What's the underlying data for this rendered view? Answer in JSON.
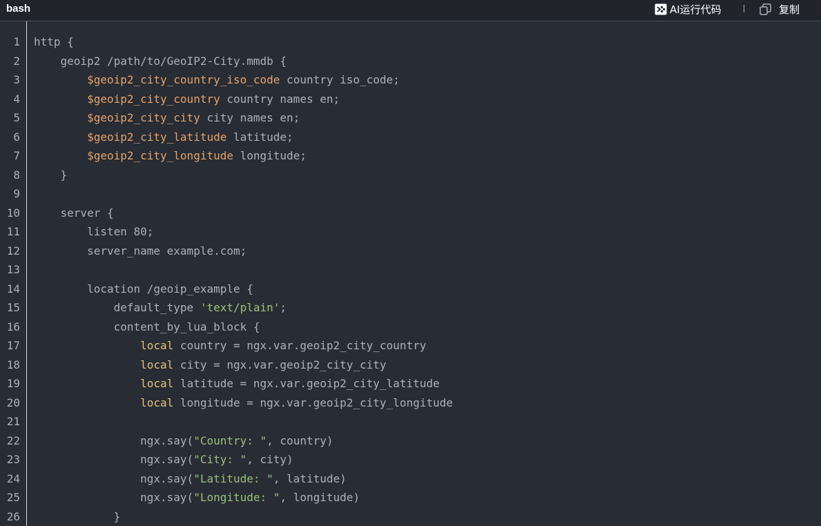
{
  "toolbar": {
    "language": "bash",
    "ai_run_label": "AI运行代码",
    "ai_run_icon": "ai-run-icon",
    "copy_label": "复制",
    "copy_icon": "copy-icon"
  },
  "colors": {
    "background": "#282c34",
    "toolbar_background": "#21252b",
    "plain_text": "#abb2bf",
    "variable": "#e5a46b",
    "keyword": "#e5c07b",
    "string": "#98c379"
  },
  "code": {
    "lines": [
      {
        "n": "1",
        "tokens": [
          {
            "t": "plain",
            "v": "http {"
          }
        ]
      },
      {
        "n": "2",
        "tokens": [
          {
            "t": "plain",
            "v": "    geoip2 /path/to/GeoIP2-City.mmdb {"
          }
        ]
      },
      {
        "n": "3",
        "tokens": [
          {
            "t": "plain",
            "v": "        "
          },
          {
            "t": "var",
            "v": "$geoip2_city_country_iso_code"
          },
          {
            "t": "plain",
            "v": " country iso_code;"
          }
        ]
      },
      {
        "n": "4",
        "tokens": [
          {
            "t": "plain",
            "v": "        "
          },
          {
            "t": "var",
            "v": "$geoip2_city_country"
          },
          {
            "t": "plain",
            "v": " country names en;"
          }
        ]
      },
      {
        "n": "5",
        "tokens": [
          {
            "t": "plain",
            "v": "        "
          },
          {
            "t": "var",
            "v": "$geoip2_city_city"
          },
          {
            "t": "plain",
            "v": " city names en;"
          }
        ]
      },
      {
        "n": "6",
        "tokens": [
          {
            "t": "plain",
            "v": "        "
          },
          {
            "t": "var",
            "v": "$geoip2_city_latitude"
          },
          {
            "t": "plain",
            "v": " latitude;"
          }
        ]
      },
      {
        "n": "7",
        "tokens": [
          {
            "t": "plain",
            "v": "        "
          },
          {
            "t": "var",
            "v": "$geoip2_city_longitude"
          },
          {
            "t": "plain",
            "v": " longitude;"
          }
        ]
      },
      {
        "n": "8",
        "tokens": [
          {
            "t": "plain",
            "v": "    }"
          }
        ]
      },
      {
        "n": "9",
        "tokens": [
          {
            "t": "plain",
            "v": ""
          }
        ]
      },
      {
        "n": "10",
        "tokens": [
          {
            "t": "plain",
            "v": "    server {"
          }
        ]
      },
      {
        "n": "11",
        "tokens": [
          {
            "t": "plain",
            "v": "        listen 80;"
          }
        ]
      },
      {
        "n": "12",
        "tokens": [
          {
            "t": "plain",
            "v": "        server_name example.com;"
          }
        ]
      },
      {
        "n": "13",
        "tokens": [
          {
            "t": "plain",
            "v": ""
          }
        ]
      },
      {
        "n": "14",
        "tokens": [
          {
            "t": "plain",
            "v": "        location /geoip_example {"
          }
        ]
      },
      {
        "n": "15",
        "tokens": [
          {
            "t": "plain",
            "v": "            default_type "
          },
          {
            "t": "str",
            "v": "'text/plain'"
          },
          {
            "t": "plain",
            "v": ";"
          }
        ]
      },
      {
        "n": "16",
        "tokens": [
          {
            "t": "plain",
            "v": "            content_by_lua_block {"
          }
        ]
      },
      {
        "n": "17",
        "tokens": [
          {
            "t": "plain",
            "v": "                "
          },
          {
            "t": "kw",
            "v": "local"
          },
          {
            "t": "plain",
            "v": " country = ngx.var.geoip2_city_country"
          }
        ]
      },
      {
        "n": "18",
        "tokens": [
          {
            "t": "plain",
            "v": "                "
          },
          {
            "t": "kw",
            "v": "local"
          },
          {
            "t": "plain",
            "v": " city = ngx.var.geoip2_city_city"
          }
        ]
      },
      {
        "n": "19",
        "tokens": [
          {
            "t": "plain",
            "v": "                "
          },
          {
            "t": "kw",
            "v": "local"
          },
          {
            "t": "plain",
            "v": " latitude = ngx.var.geoip2_city_latitude"
          }
        ]
      },
      {
        "n": "20",
        "tokens": [
          {
            "t": "plain",
            "v": "                "
          },
          {
            "t": "kw",
            "v": "local"
          },
          {
            "t": "plain",
            "v": " longitude = ngx.var.geoip2_city_longitude"
          }
        ]
      },
      {
        "n": "21",
        "tokens": [
          {
            "t": "plain",
            "v": ""
          }
        ]
      },
      {
        "n": "22",
        "tokens": [
          {
            "t": "plain",
            "v": "                ngx.say("
          },
          {
            "t": "str",
            "v": "\"Country: \""
          },
          {
            "t": "plain",
            "v": ", country)"
          }
        ]
      },
      {
        "n": "23",
        "tokens": [
          {
            "t": "plain",
            "v": "                ngx.say("
          },
          {
            "t": "str",
            "v": "\"City: \""
          },
          {
            "t": "plain",
            "v": ", city)"
          }
        ]
      },
      {
        "n": "24",
        "tokens": [
          {
            "t": "plain",
            "v": "                ngx.say("
          },
          {
            "t": "str",
            "v": "\"Latitude: \""
          },
          {
            "t": "plain",
            "v": ", latitude)"
          }
        ]
      },
      {
        "n": "25",
        "tokens": [
          {
            "t": "plain",
            "v": "                ngx.say("
          },
          {
            "t": "str",
            "v": "\"Longitude: \""
          },
          {
            "t": "plain",
            "v": ", longitude)"
          }
        ]
      },
      {
        "n": "26",
        "tokens": [
          {
            "t": "plain",
            "v": "            }"
          }
        ]
      }
    ]
  }
}
